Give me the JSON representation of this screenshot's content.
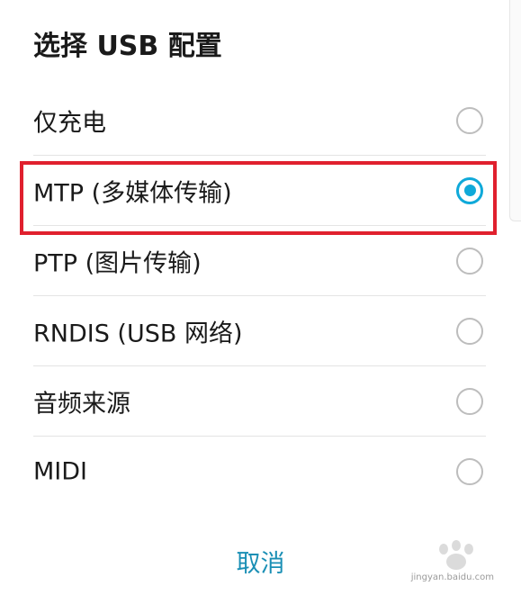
{
  "dialog": {
    "title": "选择 USB 配置",
    "options": [
      {
        "label": "仅充电",
        "selected": false
      },
      {
        "label": "MTP (多媒体传输)",
        "selected": true
      },
      {
        "label": "PTP (图片传输)",
        "selected": false
      },
      {
        "label": "RNDIS (USB 网络)",
        "selected": false
      },
      {
        "label": "音频来源",
        "selected": false
      },
      {
        "label": "MIDI",
        "selected": false
      }
    ],
    "cancel_label": "取消"
  },
  "watermark": {
    "text": "jingyan.baidu.com"
  },
  "colors": {
    "accent": "#0fa9d9",
    "cancel_text": "#1a8fb5",
    "highlight_border": "#e0202e"
  }
}
